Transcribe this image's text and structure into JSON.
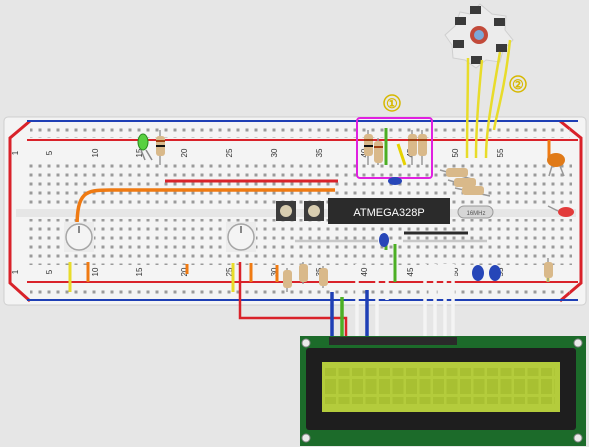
{
  "breadboard": {
    "column_numbers_top": [
      "1",
      "5",
      "10",
      "15",
      "20",
      "25",
      "30",
      "35",
      "40",
      "45",
      "50",
      "55"
    ],
    "column_numbers_bottom": [
      "1",
      "5",
      "10",
      "15",
      "20",
      "25",
      "30",
      "35",
      "40",
      "45",
      "50",
      "55"
    ]
  },
  "components": {
    "mcu_label": "ATMEGA328P",
    "crystal_label": "16MHz"
  },
  "annotations": {
    "marker_1": "①",
    "marker_2": "②"
  },
  "colors": {
    "breadboard": "#f2f2f2",
    "rail_red": "#d9222a",
    "rail_blue": "#1e3fb5",
    "marker_box": "#e020e0",
    "marker_text": "#e0c000",
    "lcd_board": "#1c6b2a",
    "lcd_screen": "#b4cc3c"
  }
}
